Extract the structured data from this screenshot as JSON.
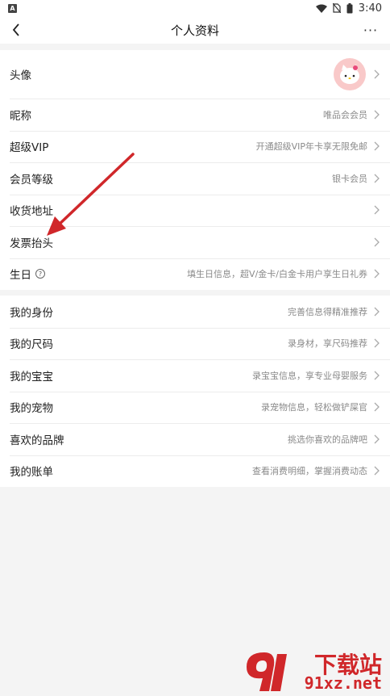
{
  "statusbar": {
    "time": "3:40",
    "notification_icon": "A"
  },
  "header": {
    "title": "个人资料",
    "more": "···"
  },
  "profile": [
    {
      "label": "头像",
      "value": "",
      "type": "avatar"
    },
    {
      "label": "昵称",
      "value": "唯品会会员"
    },
    {
      "label": "超级VIP",
      "value": "开通超级VIP年卡享无限免邮"
    },
    {
      "label": "会员等级",
      "value": "银卡会员"
    },
    {
      "label": "收货地址",
      "value": ""
    },
    {
      "label": "发票抬头",
      "value": ""
    },
    {
      "label": "生日",
      "value": "填生日信息，超V/金卡/白金卡用户享生日礼券",
      "help": "?"
    }
  ],
  "extras": [
    {
      "label": "我的身份",
      "value": "完善信息得精准推荐"
    },
    {
      "label": "我的尺码",
      "value": "录身材，享尺码推荐"
    },
    {
      "label": "我的宝宝",
      "value": "录宝宝信息，享专业母婴服务"
    },
    {
      "label": "我的宠物",
      "value": "录宠物信息，轻松做铲屎官"
    },
    {
      "label": "喜欢的品牌",
      "value": "挑选你喜欢的品牌吧"
    },
    {
      "label": "我的账单",
      "value": "查看消费明细，掌握消费动态"
    }
  ],
  "watermark": {
    "brand": "下载站",
    "domain": "91xz.net"
  },
  "colors": {
    "annotation_arrow": "#d0272a",
    "watermark": "#d0272a"
  }
}
